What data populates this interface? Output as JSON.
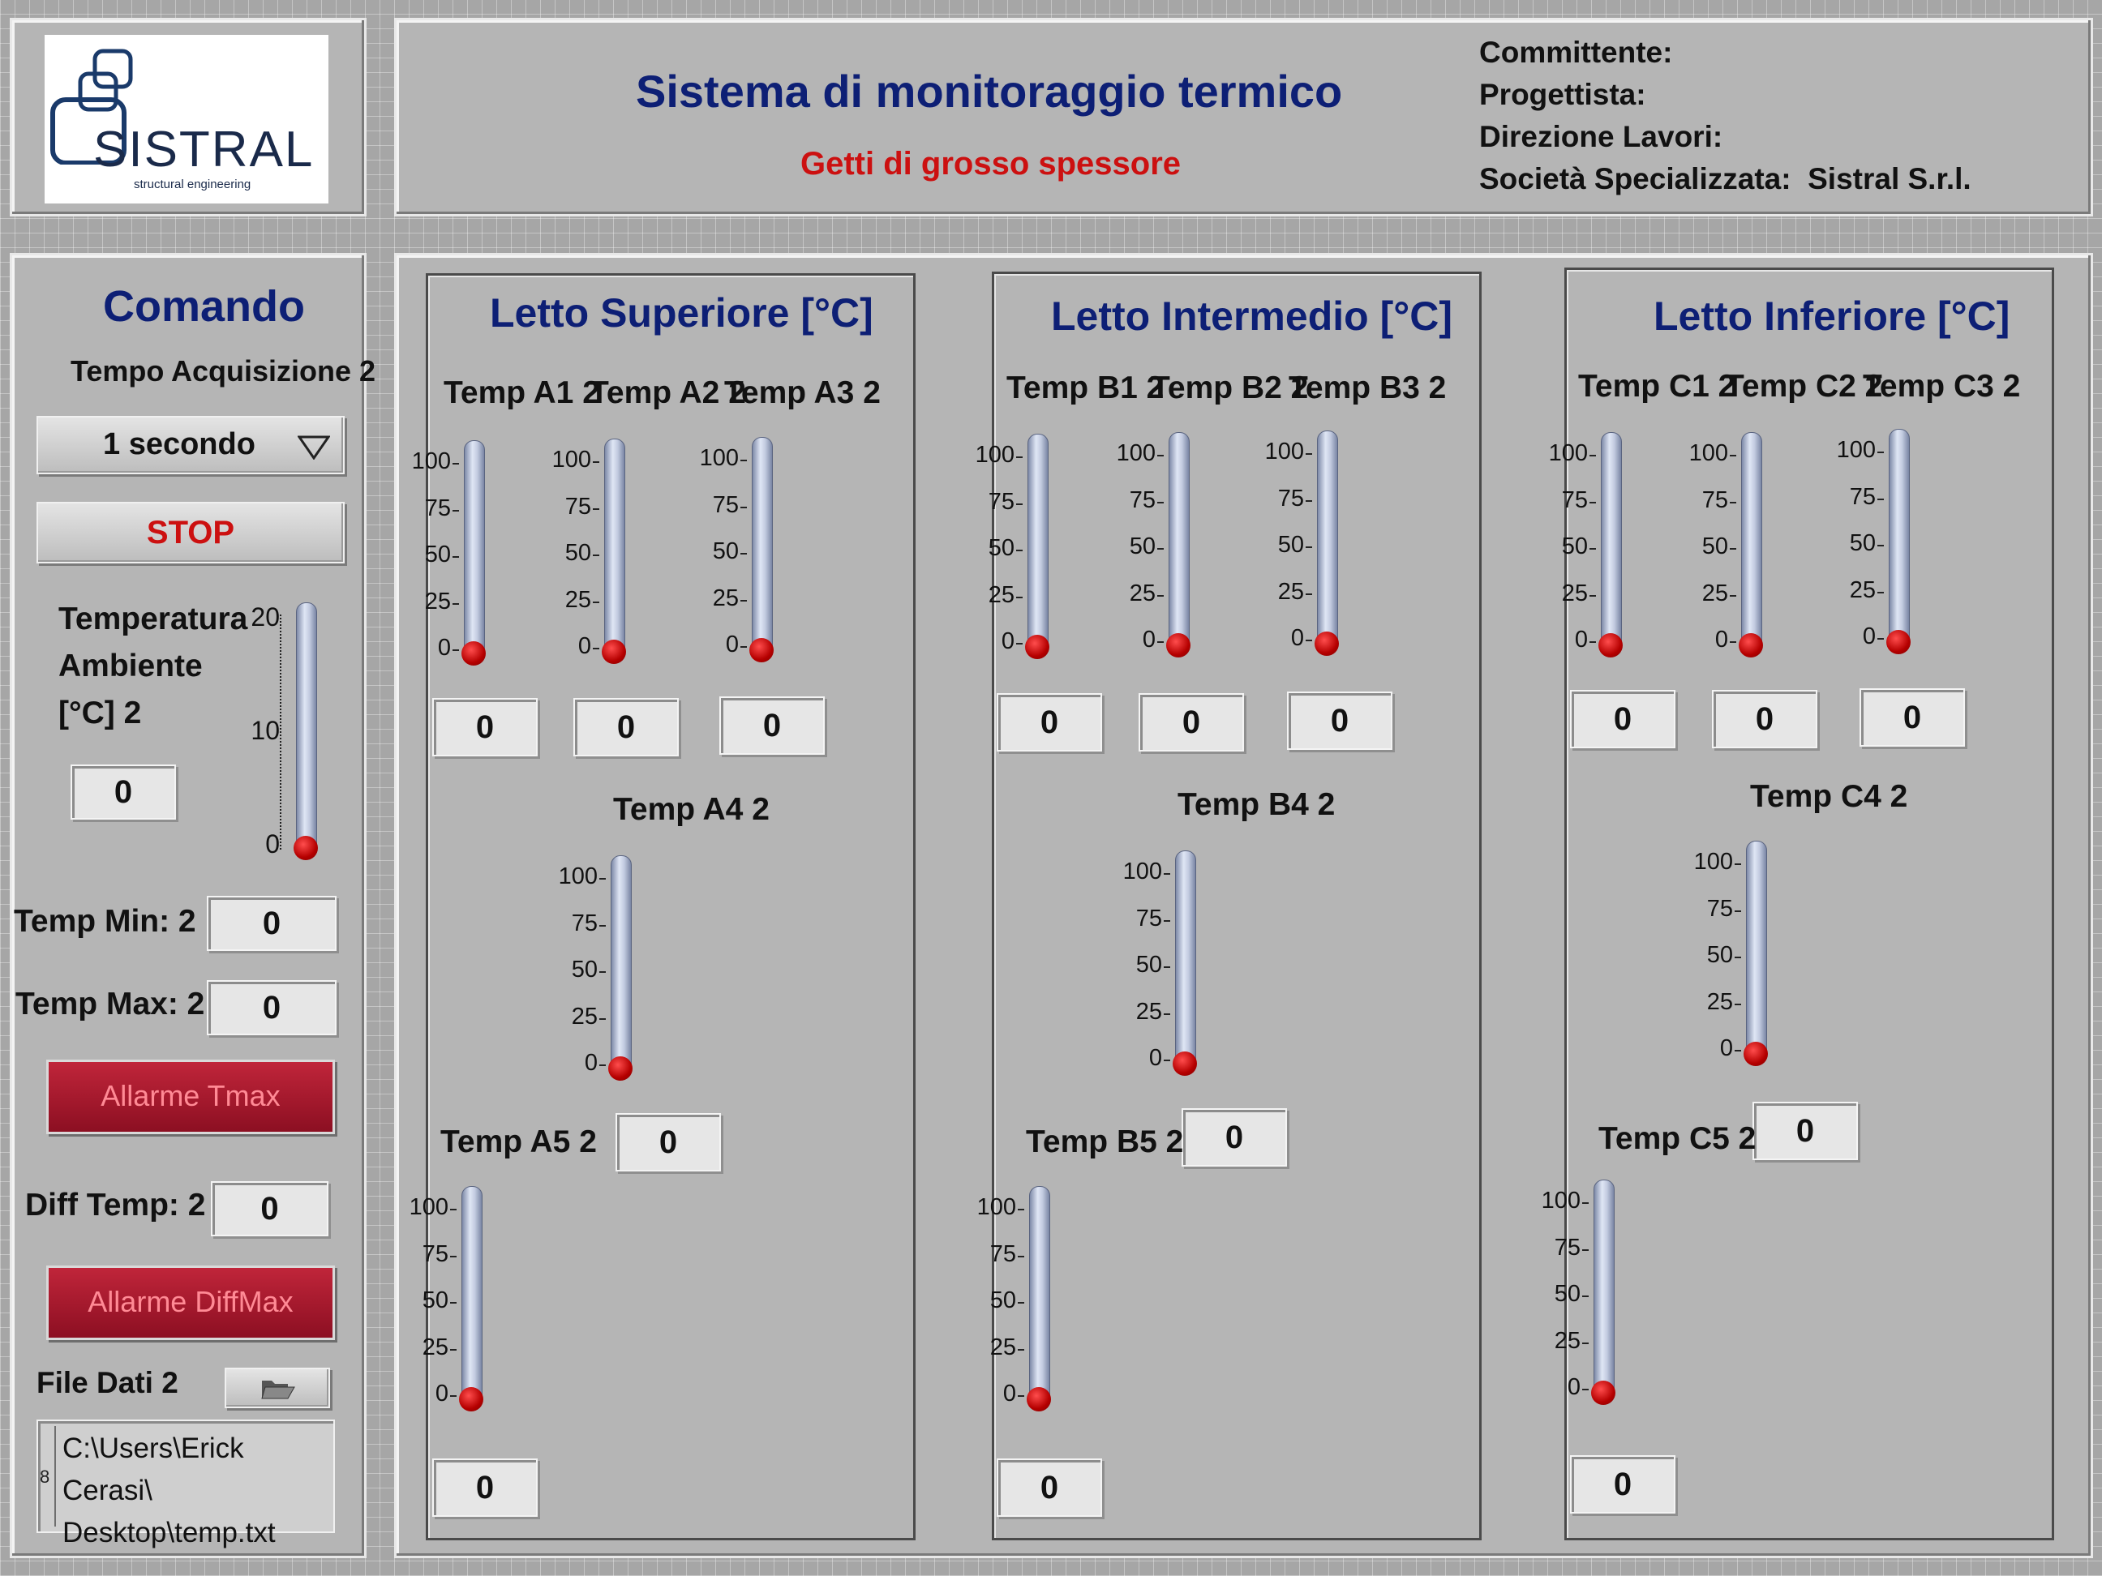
{
  "header": {
    "logo_text": "SISTRAL",
    "logo_tagline": "structural engineering",
    "title": "Sistema di monitoraggio termico",
    "subtitle": "Getti di grosso spessore",
    "info": [
      {
        "label": "Committente:",
        "value": ""
      },
      {
        "label": "Progettista:",
        "value": ""
      },
      {
        "label": "Direzione Lavori:",
        "value": ""
      },
      {
        "label": "Società Specializzata:",
        "value": "Sistral S.r.l."
      }
    ]
  },
  "command": {
    "title": "Comando",
    "acq_label": "Tempo Acquisizione 2",
    "acq_value": "1 secondo",
    "stop_label": "STOP",
    "amb_label_1": "Temperatura",
    "amb_label_2": "Ambiente",
    "amb_label_3": "[°C] 2",
    "amb_value": "0",
    "amb_scale": [
      "20",
      "10",
      "0"
    ],
    "tmin_label": "Temp Min: 2",
    "tmin_value": "0",
    "tmax_label": "Temp Max: 2",
    "tmax_value": "0",
    "alarm_tmax": "Allarme Tmax",
    "diff_label": "Diff Temp: 2",
    "diff_value": "0",
    "alarm_diff": "Allarme DiffMax",
    "file_label": "File Dati 2",
    "file_path_1": "C:\\Users\\Erick Cerasi\\",
    "file_path_2": "Desktop\\temp.txt",
    "file_marker": "8"
  },
  "gauge_scale": [
    "100",
    "75",
    "50",
    "25",
    "0"
  ],
  "groups": [
    {
      "title": "Letto Superiore [°C]",
      "sensors": [
        {
          "label": "Temp A1 2",
          "value": "0"
        },
        {
          "label": "Temp A2 2",
          "value": "0"
        },
        {
          "label": "Temp A3 2",
          "value": "0"
        },
        {
          "label": "Temp A4 2",
          "value": "0"
        },
        {
          "label": "Temp A5 2",
          "value": "0"
        }
      ]
    },
    {
      "title": "Letto Intermedio [°C]",
      "sensors": [
        {
          "label": "Temp B1 2",
          "value": "0"
        },
        {
          "label": "Temp B2 2",
          "value": "0"
        },
        {
          "label": "Temp B3 2",
          "value": "0"
        },
        {
          "label": "Temp B4 2",
          "value": "0"
        },
        {
          "label": "Temp B5 2",
          "value": "0"
        }
      ]
    },
    {
      "title": "Letto Inferiore [°C]",
      "sensors": [
        {
          "label": "Temp C1 2",
          "value": "0"
        },
        {
          "label": "Temp C2 2",
          "value": "0"
        },
        {
          "label": "Temp C3 2",
          "value": "0"
        },
        {
          "label": "Temp C4 2",
          "value": "0"
        },
        {
          "label": "Temp C5 2",
          "value": "0"
        }
      ]
    }
  ]
}
